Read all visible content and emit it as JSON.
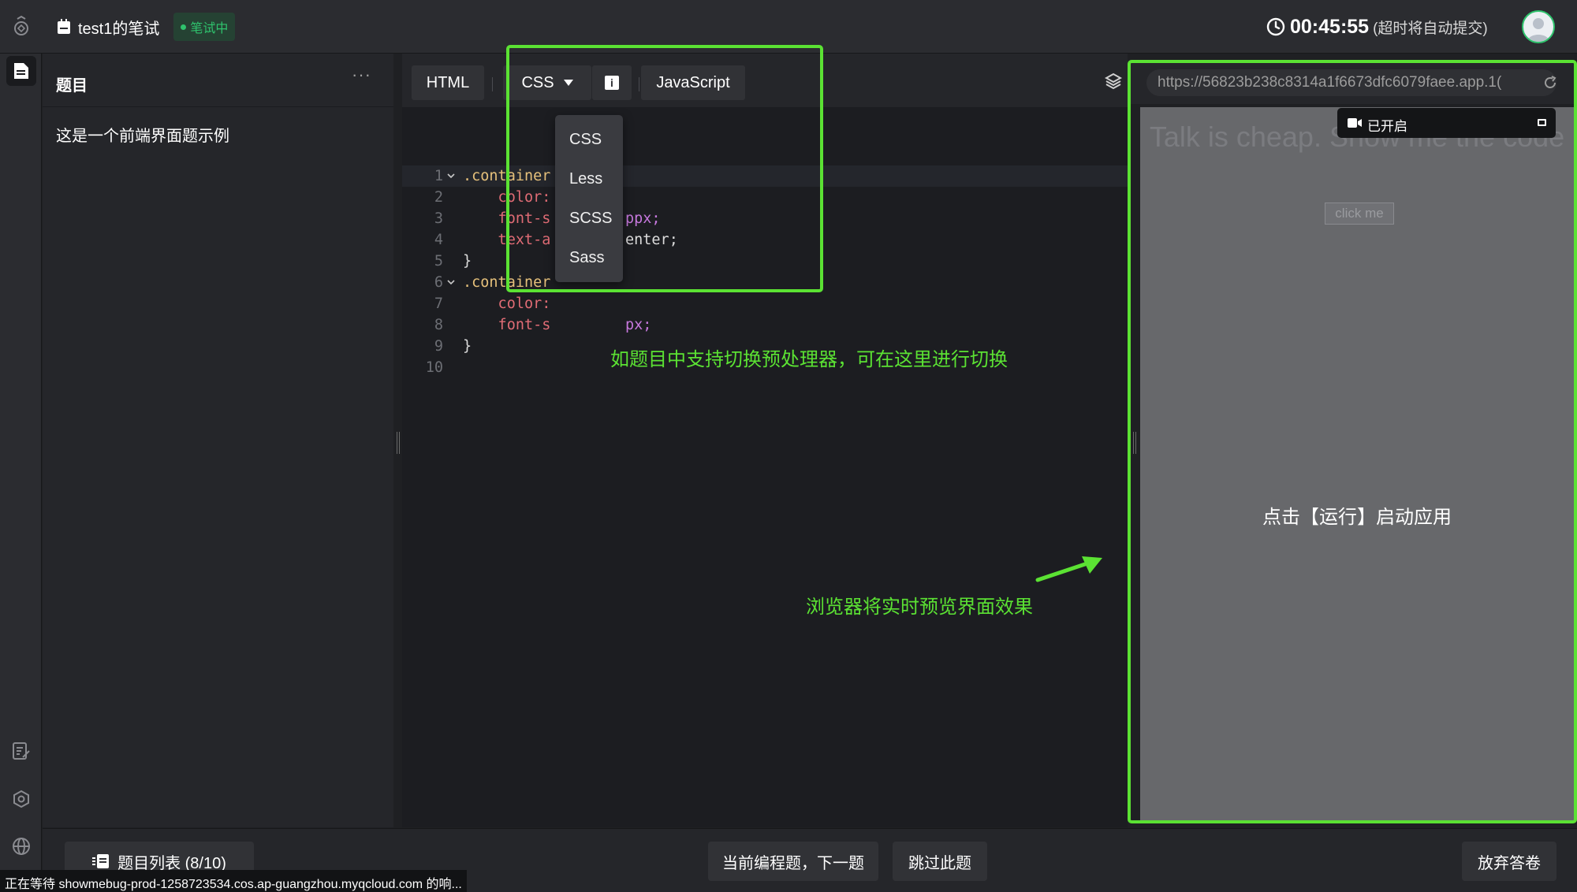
{
  "header": {
    "exam_title": "test1的笔试",
    "status_badge": "笔试中",
    "timer": "00:45:55",
    "timer_note": "(超时将自动提交)"
  },
  "question_panel": {
    "title": "题目",
    "more": "···",
    "description": "这是一个前端界面题示例"
  },
  "editor": {
    "tabs": {
      "html": "HTML",
      "css": "CSS",
      "info": "i",
      "javascript": "JavaScript"
    },
    "lines": [
      {
        "n": "1",
        "text": ".container"
      },
      {
        "n": "2",
        "text": "    color:"
      },
      {
        "n": "3",
        "text": "    font-s"
      },
      {
        "n": "4",
        "text": "    text-a"
      },
      {
        "n": "5",
        "text": "}"
      },
      {
        "n": "6",
        "text": ".container"
      },
      {
        "n": "7",
        "text": "    color:"
      },
      {
        "n": "8",
        "text": "    font-s"
      },
      {
        "n": "9",
        "text": "}"
      },
      {
        "n": "10",
        "text": ""
      }
    ],
    "tails": {
      "line3": "px;",
      "line4": "enter;",
      "line8": "px;"
    },
    "preprocessor_options": [
      "CSS",
      "Less",
      "SCSS",
      "Sass"
    ]
  },
  "annotations": {
    "preprocessor_hint": "如题目中支持切换预处理器，可在这里进行切换",
    "preview_hint": "浏览器将实时预览界面效果"
  },
  "preview": {
    "url": "https://56823b238c8314a1f6673dfc6079faee.app.1(",
    "ghost_title": "Talk is cheap. Show me the code",
    "ghost_button": "click me",
    "run_hint": "点击【运行】启动应用",
    "recording_label": "已开启"
  },
  "footer": {
    "question_list": "题目列表 (8/10)",
    "next_button": "当前编程题，下一题",
    "skip_button": "跳过此题",
    "abandon_button": "放弃答卷",
    "status_text": "正在等待 showmebug-prod-1258723534.cos.ap-guangzhou.myqcloud.com 的响..."
  },
  "colors": {
    "accent_green": "#5be233",
    "badge_green": "#2fc36d",
    "background": "#1f2023"
  },
  "icons": [
    "brand-icon",
    "document-icon",
    "clock-icon",
    "avatar",
    "notes-icon",
    "settings-icon",
    "globe-icon",
    "layers-icon",
    "reload-icon",
    "camera-icon",
    "list-icon"
  ]
}
